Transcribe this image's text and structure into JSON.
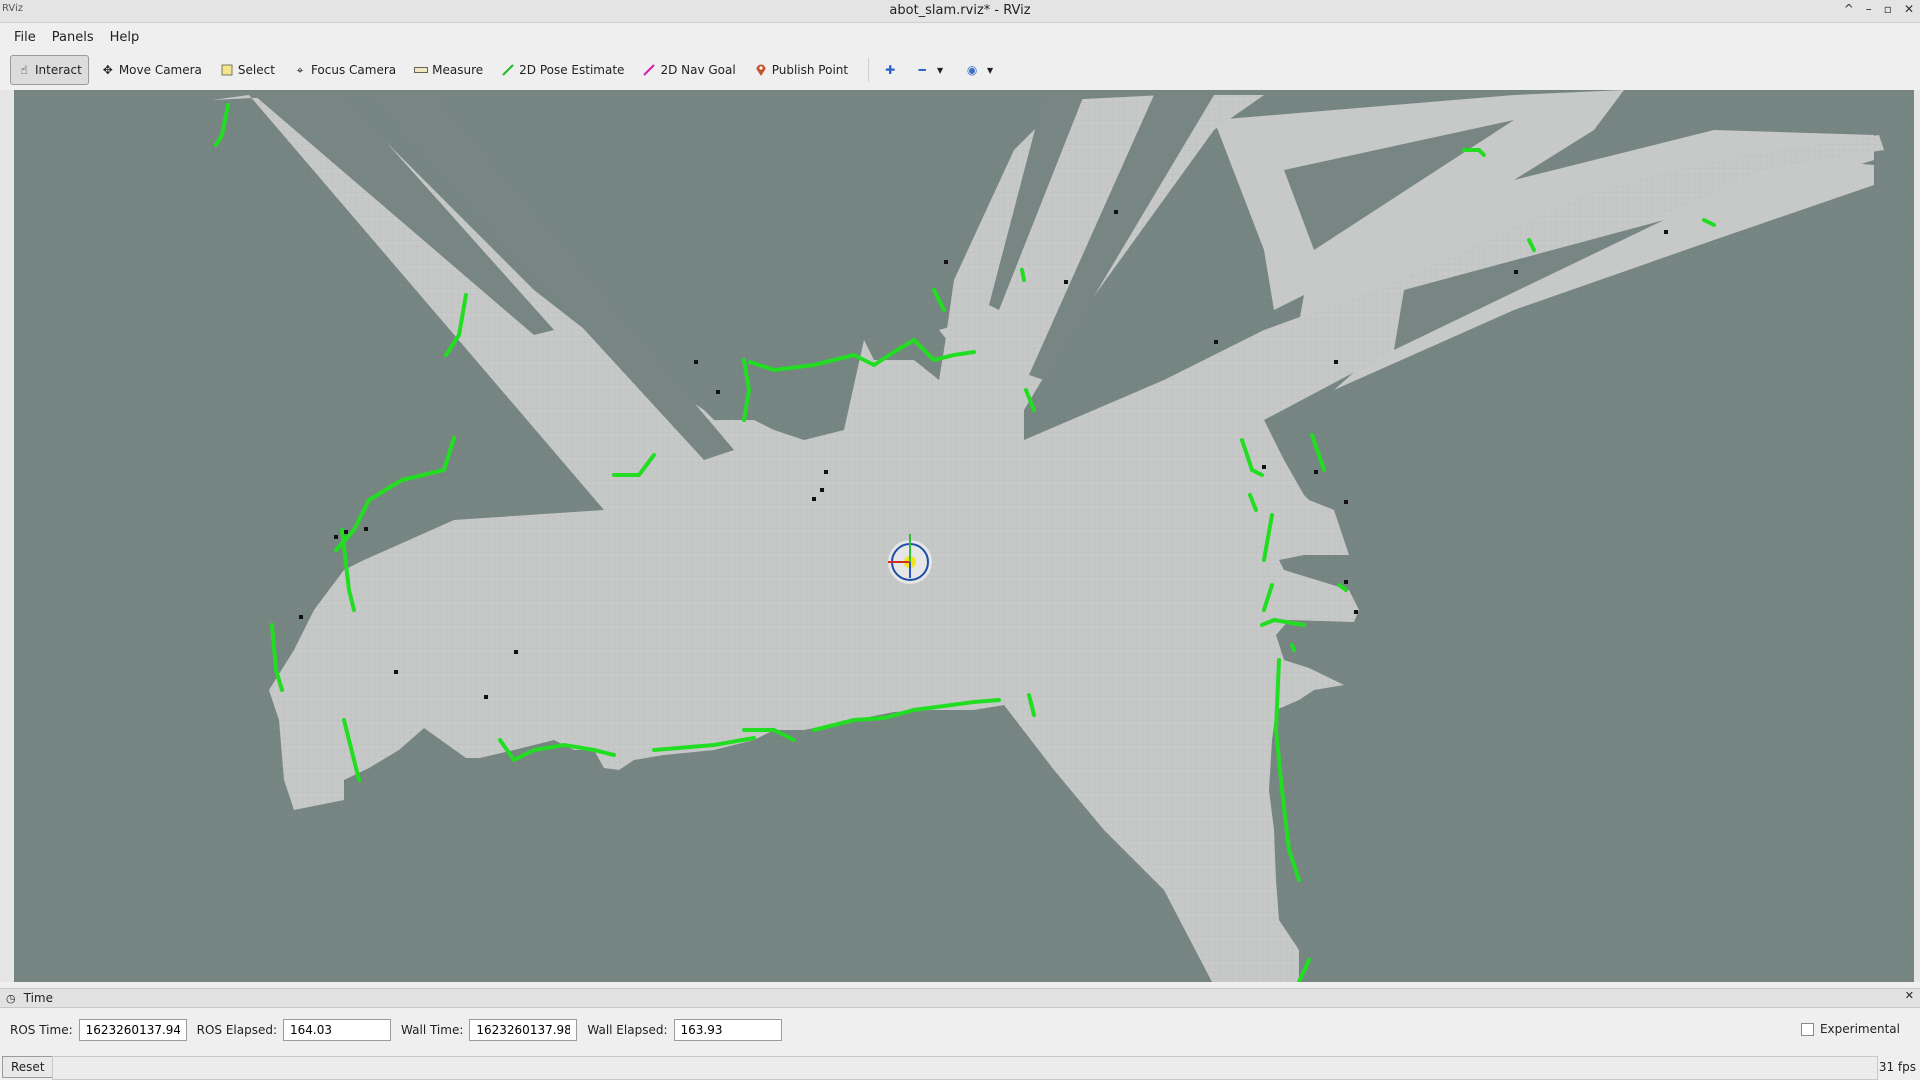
{
  "window": {
    "app_icon": "RViz",
    "title": "abot_slam.rviz* - RViz",
    "controls": [
      "^",
      "–",
      "▫",
      "✕"
    ]
  },
  "menubar": {
    "items": [
      "File",
      "Panels",
      "Help"
    ]
  },
  "toolbar": {
    "tools": [
      {
        "label": "Interact",
        "icon": "hand-cursor-icon",
        "active": true
      },
      {
        "label": "Move Camera",
        "icon": "move-camera-icon"
      },
      {
        "label": "Select",
        "icon": "select-icon"
      },
      {
        "label": "Focus Camera",
        "icon": "focus-camera-icon"
      },
      {
        "label": "Measure",
        "icon": "measure-icon"
      },
      {
        "label": "2D Pose Estimate",
        "icon": "pose-estimate-icon"
      },
      {
        "label": "2D Nav Goal",
        "icon": "nav-goal-icon"
      },
      {
        "label": "Publish Point",
        "icon": "publish-point-icon"
      }
    ],
    "extra_icons": [
      "plus-icon",
      "minus-icon",
      "camera-view-icon"
    ]
  },
  "time_panel": {
    "title": "Time",
    "ros_time_label": "ROS Time:",
    "ros_time": "1623260137.94",
    "ros_elapsed_label": "ROS Elapsed:",
    "ros_elapsed": "164.03",
    "wall_time_label": "Wall Time:",
    "wall_time": "1623260137.98",
    "wall_elapsed_label": "Wall Elapsed:",
    "wall_elapsed": "163.93",
    "experimental_label": "Experimental"
  },
  "statusbar": {
    "reset_label": "Reset",
    "fps": "31 fps"
  },
  "colors": {
    "unknown_space": "#778683",
    "free_space": "#c7c9c8",
    "obstacle": "#111111",
    "laser_scan": "#22dd22"
  }
}
